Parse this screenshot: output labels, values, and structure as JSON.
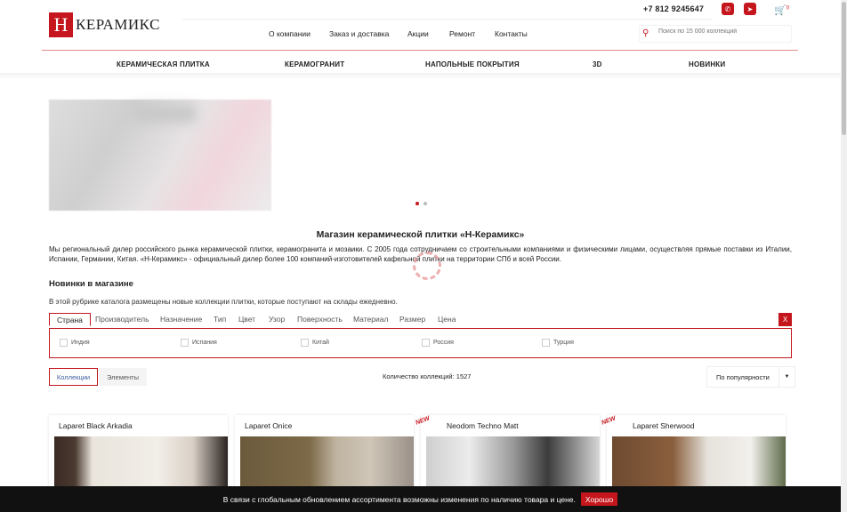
{
  "header": {
    "logo_letter": "Н",
    "logo_text": "КЕРАМИКС",
    "phone": "+7 812 9245647",
    "cart_count": "0",
    "search_placeholder": "Поиск по 15 000 коллекций",
    "top_menu": [
      "О компании",
      "Заказ и доставка",
      "Акции",
      "Ремонт",
      "Контакты"
    ],
    "categories": [
      "КЕРАМИЧЕСКАЯ ПЛИТКА",
      "КЕРАМОГРАНИТ",
      "НАПОЛЬНЫЕ ПОКРЫТИЯ",
      "3D",
      "НОВИНКИ"
    ]
  },
  "colors": {
    "accent": "#c4161c"
  },
  "intro": {
    "title": "Магазин керамической плитки «Н-Керамикс»",
    "text": "Мы региональный дилер российского рынка керамической плитки, керамогранита и мозаики. С 2005 года сотрудничаем со строительными компаниями и физическими лицами, осуществляя прямые поставки из Италии, Испании, Германии, Китая. «Н-Керамикс» - официальный дилер более 100 компаний-изготовителей кафельной плитки на территории СПб и всей России."
  },
  "news": {
    "title": "Новинки в магазине",
    "subtitle": "В этой рубрике каталога размещены новые коллекции плитки, которые поступают на склады ежедневно."
  },
  "filters": {
    "tabs": [
      "Страна",
      "Производитель",
      "Назначение",
      "Тип",
      "Цвет",
      "Узор",
      "Поверхность",
      "Материал",
      "Размер",
      "Цена"
    ],
    "close": "X",
    "countries": [
      "Индия",
      "Испания",
      "Китай",
      "Россия",
      "Турция"
    ]
  },
  "view": {
    "tab_collections": "Коллекции",
    "tab_elements": "Элементы",
    "count": "Количество коллекций: 1527",
    "sort": "По популярности"
  },
  "cards": [
    {
      "name": "Laparet Black Arkadia",
      "new": ""
    },
    {
      "name": "Laparet Onice",
      "new": ""
    },
    {
      "name": "Neodom Techno Matt",
      "new": "NEW"
    },
    {
      "name": "Laparet Sherwood",
      "new": "NEW"
    }
  ],
  "notice": {
    "text": "В связи с глобальным обновлением ассортимента возможны изменения по наличию товара и цене.",
    "button": "Хорошо"
  }
}
